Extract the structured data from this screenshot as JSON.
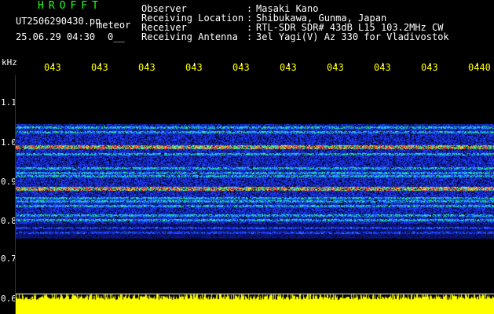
{
  "header": {
    "title": "HROFFT",
    "filename": "UT2506290430.pn",
    "meteor_label": "meteor",
    "datetime": "25.06.29 04:30",
    "counter": "0__"
  },
  "info": {
    "rows": [
      {
        "label": "Observer",
        "value": "Masaki Kano"
      },
      {
        "label": "Receiving Location",
        "value": "Shibukawa, Gunma, Japan"
      },
      {
        "label": "Receiver",
        "value": "RTL-SDR SDR# 43dB L15 103.2MHz CW"
      },
      {
        "label": "Receiving Antenna",
        "value": "3el Yagi(V) Az 330 for Vladivostok"
      }
    ]
  },
  "axis": {
    "unit": "kHz",
    "y_labels": [
      "1.1",
      "1.0",
      "0.9",
      "0.8",
      "0.7",
      "0.6"
    ],
    "time_labels": [
      "043",
      "043",
      "043",
      "043",
      "043",
      "043",
      "043",
      "043",
      "043",
      "0440"
    ]
  },
  "colors": {
    "background": "#000000",
    "text": "#ffffff",
    "title": "#22ff22",
    "time_labels": "#ffff00",
    "power_trace": "#ffff00",
    "spectrum_low": "#00008b",
    "spectrum_mid": "#00ff80",
    "spectrum_high": "#ff2020"
  }
}
